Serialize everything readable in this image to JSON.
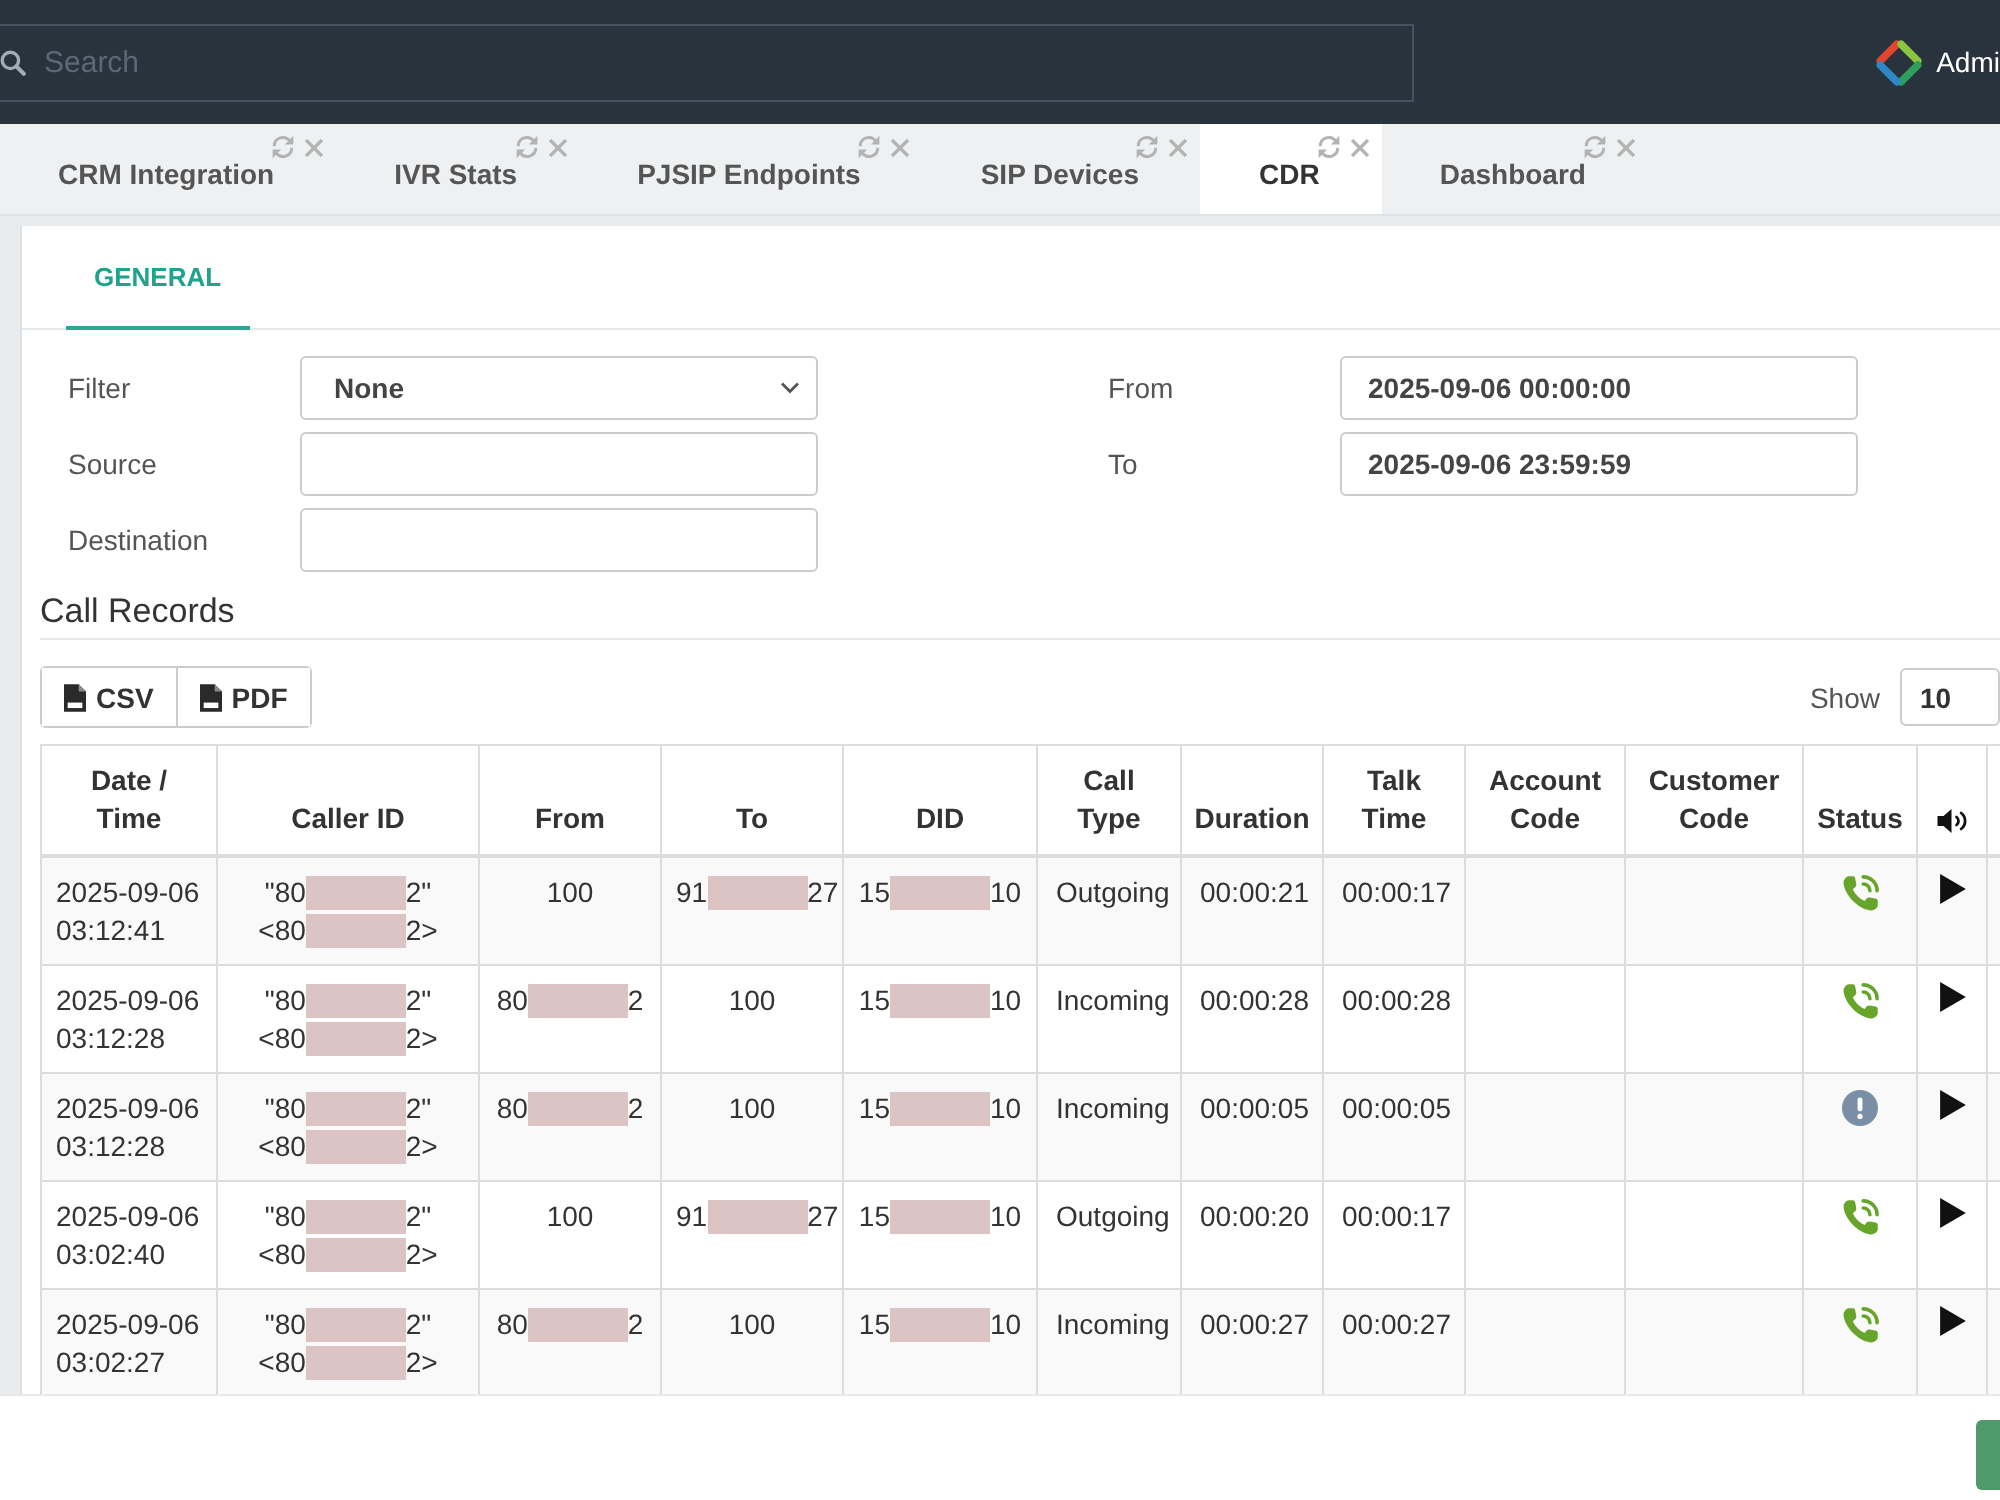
{
  "header": {
    "search": {
      "placeholder": "Search"
    },
    "user_name": "Admi"
  },
  "tabs": [
    {
      "label": "CRM Integration",
      "selected": false
    },
    {
      "label": "IVR Stats",
      "selected": false
    },
    {
      "label": "PJSIP Endpoints",
      "selected": false
    },
    {
      "label": "SIP Devices",
      "selected": false
    },
    {
      "label": "CDR",
      "selected": true
    },
    {
      "label": "Dashboard",
      "selected": false
    }
  ],
  "subtabs": [
    {
      "label": "GENERAL",
      "selected": true
    }
  ],
  "filters": {
    "left": [
      {
        "label": "Filter",
        "kind": "select",
        "value": "None"
      },
      {
        "label": "Source",
        "kind": "input"
      },
      {
        "label": "Destination",
        "kind": "input"
      }
    ],
    "right": [
      {
        "label": "From",
        "kind": "input",
        "value": "2025-09-06 00:00:00"
      },
      {
        "label": "To",
        "kind": "input",
        "value": "2025-09-06 23:59:59"
      }
    ]
  },
  "call_records": {
    "title": "Call Records",
    "export_buttons": [
      "CSV",
      "PDF"
    ],
    "page_size": {
      "label": "Show",
      "value": "10"
    },
    "table": {
      "columns": [
        {
          "kind": "text",
          "label": "Date / Time"
        },
        {
          "kind": "text",
          "label": "Caller ID"
        },
        {
          "kind": "text",
          "label": "From"
        },
        {
          "kind": "text",
          "label": "To"
        },
        {
          "kind": "text",
          "label": "DID"
        },
        {
          "kind": "text",
          "label": "Call Type"
        },
        {
          "kind": "text",
          "label": "Duration"
        },
        {
          "kind": "text",
          "label": "Talk Time"
        },
        {
          "kind": "text",
          "label": "Account Code"
        },
        {
          "kind": "text",
          "label": "Customer Code"
        },
        {
          "kind": "text",
          "label": "Status"
        },
        {
          "kind": "audio"
        }
      ],
      "rows": [
        {
          "date_time": "2025-09-06 03:12:41",
          "caller_id": {
            "name": {
              "start": "\"80",
              "end": "2\""
            },
            "number": {
              "start": "<80",
              "end": "2>"
            }
          },
          "from": "100",
          "to": {
            "start": "91",
            "end": "27"
          },
          "did": {
            "start": "15",
            "end": "10"
          },
          "call_type": "Outgoing",
          "duration": "00:00:21",
          "talk_time": "00:00:17",
          "answered": true
        },
        {
          "date_time": "2025-09-06 03:12:28",
          "caller_id": {
            "name": {
              "start": "\"80",
              "end": "2\""
            },
            "number": {
              "start": "<80",
              "end": "2>"
            }
          },
          "from": {
            "start": "80",
            "end": "2"
          },
          "to": "100",
          "did": {
            "start": "15",
            "end": "10"
          },
          "call_type": "Incoming",
          "duration": "00:00:28",
          "talk_time": "00:00:28",
          "answered": true
        },
        {
          "date_time": "2025-09-06 03:12:28",
          "caller_id": {
            "name": {
              "start": "\"80",
              "end": "2\""
            },
            "number": {
              "start": "<80",
              "end": "2>"
            }
          },
          "from": {
            "start": "80",
            "end": "2"
          },
          "to": "100",
          "did": {
            "start": "15",
            "end": "10"
          },
          "call_type": "Incoming",
          "duration": "00:00:05",
          "talk_time": "00:00:05",
          "answered": false
        },
        {
          "date_time": "2025-09-06 03:02:40",
          "caller_id": {
            "name": {
              "start": "\"80",
              "end": "2\""
            },
            "number": {
              "start": "<80",
              "end": "2>"
            }
          },
          "from": "100",
          "to": {
            "start": "91",
            "end": "27"
          },
          "did": {
            "start": "15",
            "end": "10"
          },
          "call_type": "Outgoing",
          "duration": "00:00:20",
          "talk_time": "00:00:17",
          "answered": true
        },
        {
          "date_time": "2025-09-06 03:02:27",
          "caller_id": {
            "name": {
              "start": "\"80",
              "end": "2\""
            },
            "number": {
              "start": "<80",
              "end": "2>"
            }
          },
          "from": {
            "start": "80",
            "end": "2"
          },
          "to": "100",
          "did": {
            "start": "15",
            "end": "10"
          },
          "call_type": "Incoming",
          "duration": "00:00:27",
          "talk_time": "00:00:27",
          "answered": true
        }
      ]
    }
  }
}
